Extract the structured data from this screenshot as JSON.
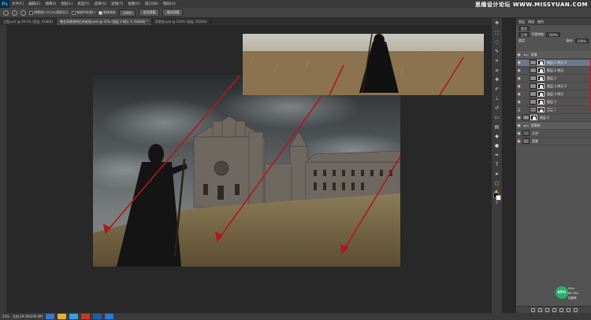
{
  "app": {
    "logo": "Ps",
    "menu": [
      "文件(F)",
      "编辑(E)",
      "图像(I)",
      "图层(L)",
      "类型(Y)",
      "选择(S)",
      "滤镜(T)",
      "视图(V)",
      "窗口(W)",
      "帮助(H)"
    ],
    "watermark": "思缘设计论坛 WWW.MISSYUAN.COM"
  },
  "options": {
    "check1": "调整窗口大小以满屏显示",
    "check2": "缩放所有窗口",
    "check3": "细微缩放",
    "zoom_value": "100%",
    "fit_screen": "适合屏幕",
    "fill_screen": "填充屏幕"
  },
  "tabs": [
    {
      "label": "主图.psd @ 29.5% (图层, RGB/8)"
    },
    {
      "label": "教会背景透明后的抠图.psd @ 25% (图层 2 拷贝 2, RGB/8) *"
    },
    {
      "label": "背景图.psd @ 100% (图层, RGB/8)"
    }
  ],
  "layers_panel": {
    "tabs": [
      "图层",
      "通道",
      "路径"
    ],
    "kind_label": "类型",
    "blend_mode": "正常",
    "opacity_label": "不透明度:",
    "opacity_value": "100%",
    "lock_label": "锁定:",
    "fill_label": "填充:",
    "fill_value": "100%",
    "layers": [
      {
        "name": "背景",
        "type": "group-top"
      },
      {
        "name": "图层 2 拷贝 2",
        "type": "masked"
      },
      {
        "name": "图层 2 拷贝",
        "type": "masked"
      },
      {
        "name": "图层 2",
        "type": "masked"
      },
      {
        "name": "图层 3 拷贝 2",
        "type": "masked"
      },
      {
        "name": "图层 3 拷贝",
        "type": "masked"
      },
      {
        "name": "图层 3",
        "type": "masked"
      },
      {
        "name": "图层 1",
        "type": "masked"
      },
      {
        "name": "图层 4",
        "type": "plain"
      },
      {
        "name": "背景树",
        "type": "group"
      },
      {
        "name": "天空",
        "type": "plain"
      },
      {
        "name": "背景",
        "type": "plain"
      }
    ]
  },
  "network_badge": {
    "percent": "65%",
    "up": "0K/s",
    "down": "66.7K/s",
    "extra": "加速球"
  },
  "statusbar": {
    "zoom": "25%",
    "doc_size": "文档:29.5M/259.9M"
  },
  "colors": {
    "arrow_red": "#b0171f",
    "highlight_red": "#c8102e",
    "badge_green": "#27b06a"
  }
}
